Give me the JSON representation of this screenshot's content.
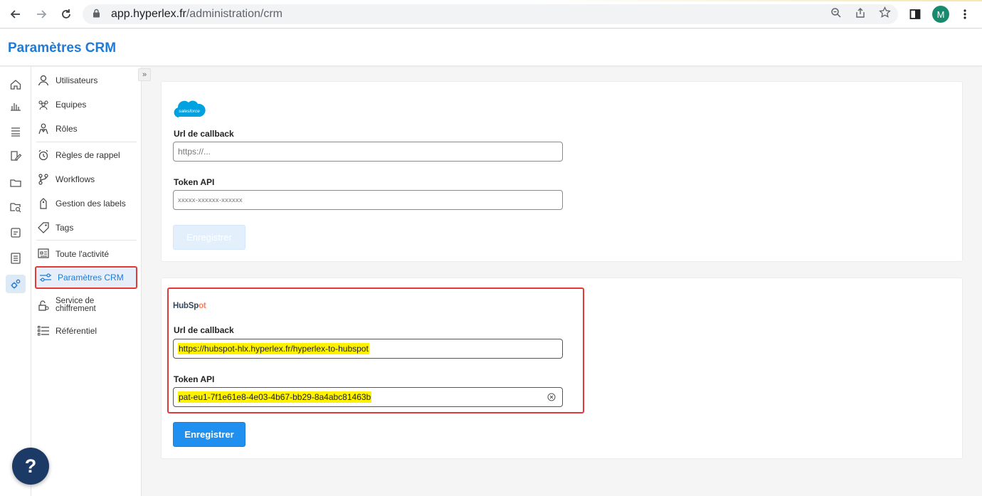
{
  "browser": {
    "url_host": "app.hyperlex.fr",
    "url_path": "/administration/crm",
    "avatar_initial": "M"
  },
  "header": {
    "title": "Paramètres CRM"
  },
  "rail": {
    "items": [
      "home-icon",
      "chart-icon",
      "inbox-icon",
      "edit-doc-icon",
      "folder-icon",
      "folder-search-icon",
      "document-icon",
      "report-icon",
      "settings-icon"
    ],
    "active": "settings-icon"
  },
  "subnav": {
    "items": [
      {
        "label": "Utilisateurs",
        "icon": "user-icon"
      },
      {
        "label": "Equipes",
        "icon": "team-icon"
      },
      {
        "label": "Rôles",
        "icon": "role-icon"
      },
      {
        "label": "Règles de rappel",
        "icon": "alarm-icon"
      },
      {
        "label": "Workflows",
        "icon": "workflow-icon"
      },
      {
        "label": "Gestion des labels",
        "icon": "label-icon"
      },
      {
        "label": "Tags",
        "icon": "tag-icon"
      },
      {
        "label": "Toute l'activité",
        "icon": "activity-icon"
      },
      {
        "label": "Paramètres CRM",
        "icon": "crm-settings-icon"
      },
      {
        "label_line1": "Service de",
        "label_line2": "chiffrement",
        "icon": "encryption-icon"
      },
      {
        "label": "Référentiel",
        "icon": "list-icon"
      }
    ],
    "active_index": 8
  },
  "salesforce": {
    "logo_text": "salesforce",
    "callback_label": "Url de callback",
    "callback_placeholder": "https://...",
    "token_label": "Token API",
    "token_placeholder": "xxxxx-xxxxxx-xxxxxx",
    "save_label": "Enregistrer"
  },
  "hubspot": {
    "logo_text_a": "HubSp",
    "logo_text_b": "ot",
    "callback_label": "Url de callback",
    "callback_value": "https://hubspot-hlx.hyperlex.fr/hyperlex-to-hubspot",
    "token_label": "Token API",
    "token_value": "pat-eu1-7f1e61e8-4e03-4b67-bb29-8a4abc81463b",
    "save_label": "Enregistrer"
  },
  "help": {
    "label": "?"
  },
  "colors": {
    "accent": "#1f7ad8",
    "primary_button": "#1f8ff0",
    "highlight": "#fff200",
    "annotation": "#e53935",
    "help_button": "#1c3a66"
  }
}
